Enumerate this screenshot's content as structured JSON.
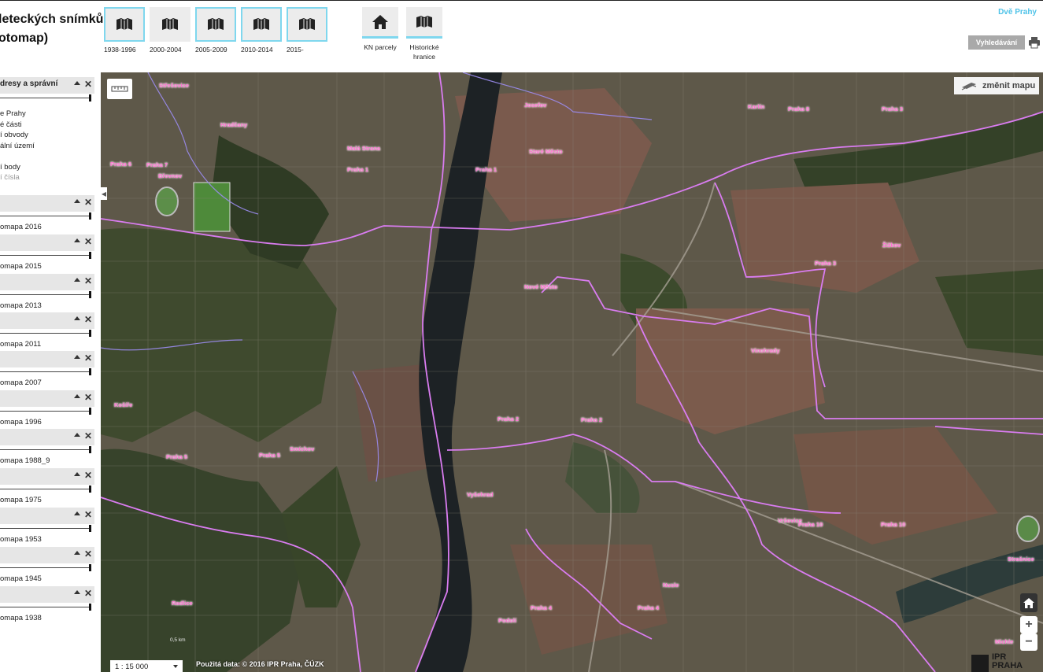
{
  "header": {
    "title_line1": "leteckých snímků",
    "title_line2": "otomap)",
    "periods": [
      {
        "label": "1938-1996",
        "active": true
      },
      {
        "label": "2000-2004",
        "active": false
      },
      {
        "label": "2005-2009",
        "active": true
      },
      {
        "label": "2010-2014",
        "active": true
      },
      {
        "label": "2015-",
        "active": true
      }
    ],
    "tools": [
      {
        "label": "KN parcely",
        "icon": "home-icon"
      },
      {
        "label": "Historické hranice",
        "icon": "map-book-icon"
      }
    ],
    "dve_prahy": "Dvě Prahy",
    "search_label": "Vyhledávání",
    "accent_color": "#7fd7ee",
    "link_color": "#4fc3e8"
  },
  "sidebar": {
    "first_layer": {
      "title": "dresy a správní",
      "items": [
        "e Prahy",
        "é části",
        "í obvody",
        "ální území",
        "",
        "í body",
        "í čísla"
      ]
    },
    "layers": [
      {
        "name": "omapa 2016"
      },
      {
        "name": "omapa 2015"
      },
      {
        "name": "omapa 2013"
      },
      {
        "name": "omapa 2011"
      },
      {
        "name": "omapa 2007"
      },
      {
        "name": "omapa 1996"
      },
      {
        "name": "omapa 1988_9"
      },
      {
        "name": "omapa 1975"
      },
      {
        "name": "omapa 1953"
      },
      {
        "name": "omapa 1945"
      },
      {
        "name": "omapa 1938"
      }
    ]
  },
  "map": {
    "change_map_label": "změnit mapu",
    "scale_value": "1 : 15 000",
    "scale_bar_label": "0,5 km",
    "attribution": "Použitá data: © 2016 IPR Praha, ČÚZK",
    "zoom_in": "+",
    "zoom_out": "−",
    "logo_line1": "IPR",
    "logo_line2": "PRAHA",
    "boundary_color": "#d97cf0",
    "labels": [
      {
        "text": "Střešovice"
      },
      {
        "text": "Hradčany"
      },
      {
        "text": "Praha 6"
      },
      {
        "text": "Praha 7"
      },
      {
        "text": "Břevnov"
      },
      {
        "text": "Malá Strana"
      },
      {
        "text": "Praha 1"
      },
      {
        "text": "Josefov"
      },
      {
        "text": "Staré Město"
      },
      {
        "text": "Praha 1"
      },
      {
        "text": "Karlín"
      },
      {
        "text": "Praha 8"
      },
      {
        "text": "Praha 3"
      },
      {
        "text": "Žižkov"
      },
      {
        "text": "Praha 3"
      },
      {
        "text": "Nové Město"
      },
      {
        "text": "Vinohrady"
      },
      {
        "text": "Košíře"
      },
      {
        "text": "Praha 2"
      },
      {
        "text": "Praha 2"
      },
      {
        "text": "Smíchov"
      },
      {
        "text": "Praha 5"
      },
      {
        "text": "Praha 5"
      },
      {
        "text": "Vyšehrad"
      },
      {
        "text": "Vršovice"
      },
      {
        "text": "Praha 10"
      },
      {
        "text": "Praha 10"
      },
      {
        "text": "Strašnice"
      },
      {
        "text": "Nusle"
      },
      {
        "text": "Praha 4"
      },
      {
        "text": "Praha 4"
      },
      {
        "text": "Podolí"
      },
      {
        "text": "Radlice"
      },
      {
        "text": "Michle"
      }
    ]
  }
}
